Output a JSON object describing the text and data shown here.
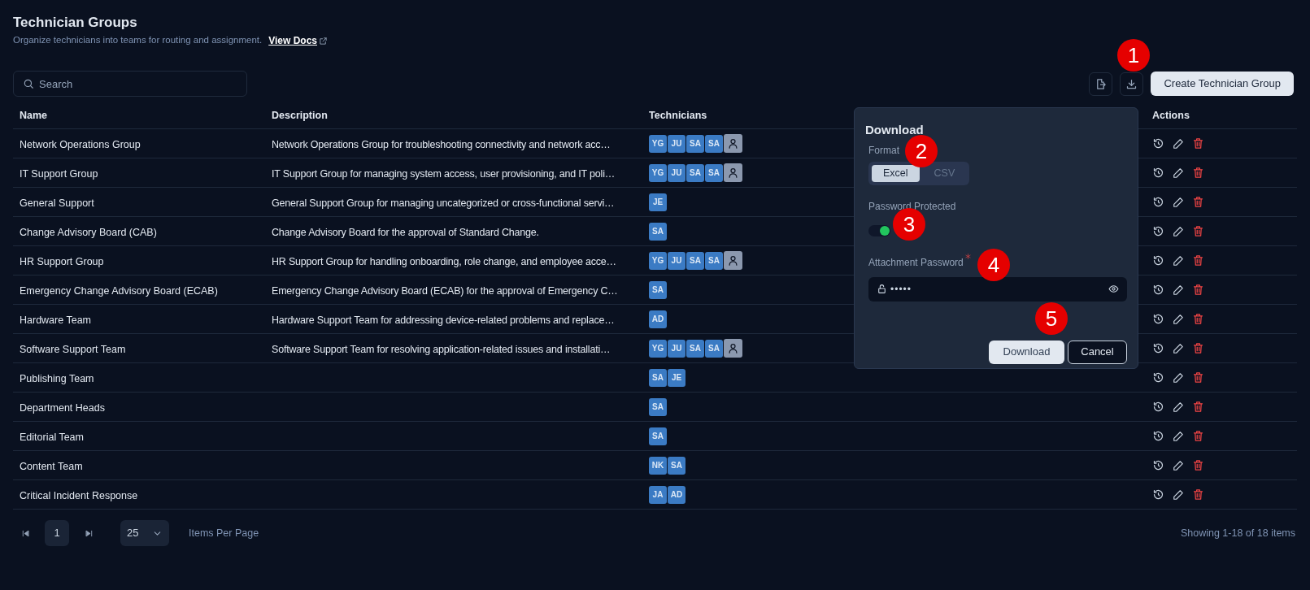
{
  "header": {
    "title": "Technician Groups",
    "subtitle": "Organize technicians into teams for routing and assignment.",
    "docs_link": "View Docs"
  },
  "search": {
    "placeholder": "Search"
  },
  "toolbar": {
    "create_button": "Create Technician Group"
  },
  "table": {
    "columns": [
      "Name",
      "Description",
      "Technicians",
      "Actions"
    ],
    "rows": [
      {
        "name": "Network Operations Group",
        "description": "Network Operations Group for troubleshooting connectivity and network acc…",
        "technicians": [
          "YG",
          "JU",
          "SA",
          "SA"
        ],
        "more": true
      },
      {
        "name": "IT Support Group",
        "description": "IT Support Group for managing system access, user provisioning, and IT poli…",
        "technicians": [
          "YG",
          "JU",
          "SA",
          "SA"
        ],
        "more": true
      },
      {
        "name": "General Support",
        "description": "General Support Group for managing uncategorized or cross-functional servi…",
        "technicians": [
          "JE"
        ],
        "more": false
      },
      {
        "name": "Change Advisory Board (CAB)",
        "description": "Change Advisory Board for the approval of Standard Change.",
        "technicians": [
          "SA"
        ],
        "more": false
      },
      {
        "name": "HR Support Group",
        "description": "HR Support Group for handling onboarding, role change, and employee acce…",
        "technicians": [
          "YG",
          "JU",
          "SA",
          "SA"
        ],
        "more": true
      },
      {
        "name": "Emergency Change Advisory Board (ECAB)",
        "description": "Emergency Change Advisory Board (ECAB) for the approval of Emergency C…",
        "technicians": [
          "SA"
        ],
        "more": false
      },
      {
        "name": "Hardware Team",
        "description": "Hardware Support Team for addressing device-related problems and replace…",
        "technicians": [
          "AD"
        ],
        "more": false
      },
      {
        "name": "Software Support Team",
        "description": "Software Support Team for resolving application-related issues and installati…",
        "technicians": [
          "YG",
          "JU",
          "SA",
          "SA"
        ],
        "more": true
      },
      {
        "name": "Publishing Team",
        "technicians": [
          "SA",
          "JE"
        ],
        "more": false
      },
      {
        "name": "Department Heads",
        "technicians": [
          "SA"
        ],
        "more": false
      },
      {
        "name": "Editorial Team",
        "technicians": [
          "SA"
        ],
        "more": false
      },
      {
        "name": "Content Team",
        "technicians": [
          "NK",
          "SA"
        ],
        "more": false
      },
      {
        "name": "Critical Incident Response",
        "technicians": [
          "JA",
          "AD"
        ],
        "more": false
      }
    ]
  },
  "pagination": {
    "page": "1",
    "per_page": "25",
    "per_page_label": "Items Per Page",
    "summary": "Showing 1-18 of 18 items"
  },
  "download_popup": {
    "title": "Download",
    "format_label": "Format",
    "formats": [
      {
        "label": "Excel",
        "selected": true
      },
      {
        "label": "CSV",
        "selected": false
      }
    ],
    "protect_label": "Password Protected",
    "protect_on": true,
    "password_label": "Attachment Password",
    "password_required": true,
    "password_value": "•••••",
    "download_button": "Download",
    "cancel_button": "Cancel"
  },
  "callouts": [
    "1",
    "2",
    "3",
    "4",
    "5"
  ]
}
